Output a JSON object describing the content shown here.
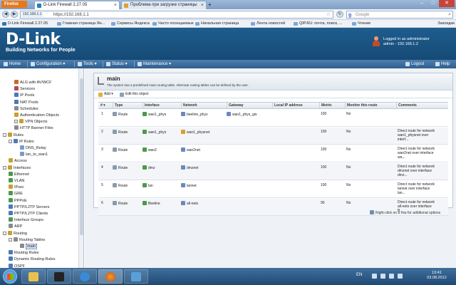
{
  "browser": {
    "menu_label": "Firefox",
    "tabs": [
      {
        "title": "D-Link Firewall 2.27.05"
      },
      {
        "title": "Проблема при загрузке страницы"
      }
    ],
    "new_tab_glyph": "+",
    "url_site": "192.168.1.1",
    "url": "https://192.168.1.1",
    "search_placeholder": "Google",
    "bookmarks": [
      "D-Link Firewall 2.27.05",
      "Главная страница Ян...",
      "Сервисы Яндекса",
      "Часто посещаемые",
      "Начальная страница",
      "Лента новостей",
      "QIP.RU: почта, поиск, ...",
      "Чтение"
    ],
    "bookmarks_menu": "Закладки"
  },
  "header": {
    "logo": "D-Link",
    "tagline": "Building Networks for People",
    "user_line1": "Logged in as administrator",
    "user_line2": "admin - 192.168.1.2"
  },
  "menu": {
    "items": [
      "Home",
      "Configuration ▾",
      "Tools ▾",
      "Status ▾",
      "Maintenance ▾"
    ],
    "logout": "Logout",
    "help": "Help"
  },
  "sidebar": {
    "items": [
      {
        "label": "ALG with AV/WCF",
        "level": 2,
        "icon": "alg-icon",
        "color": "#c86a2a"
      },
      {
        "label": "Services",
        "level": 2,
        "icon": "services-icon",
        "color": "#b84a4a"
      },
      {
        "label": "IP Pools",
        "level": 2,
        "icon": "ip-pools-icon",
        "color": "#4a7ab8"
      },
      {
        "label": "NAT Pools",
        "level": 2,
        "icon": "nat-pools-icon",
        "color": "#4a7ab8"
      },
      {
        "label": "Schedules",
        "level": 2,
        "icon": "schedules-icon",
        "color": "#8a8a8a"
      },
      {
        "label": "Authentication Objects",
        "level": 2,
        "icon": "auth-objects-icon",
        "color": "#c8a030"
      },
      {
        "label": "VPN Objects",
        "level": 2,
        "icon": "vpn-objects-icon",
        "color": "#c8a030",
        "expander": "+"
      },
      {
        "label": "HTTP Banner Files",
        "level": 2,
        "icon": "banner-files-icon",
        "color": "#8a8a8a"
      },
      {
        "label": "Rules",
        "level": 0,
        "icon": "rules-icon",
        "color": "#c8a030",
        "expander": "-"
      },
      {
        "label": "IP Rules",
        "level": 1,
        "icon": "ip-rules-icon",
        "color": "#4a7ab8",
        "expander": "-"
      },
      {
        "label": "DNS_Relay",
        "level": 3,
        "icon": "dns-relay-icon",
        "color": "#7a9ac8"
      },
      {
        "label": "lan_to_wan1",
        "level": 3,
        "icon": "lan-to-wan1-icon",
        "color": "#7a9ac8"
      },
      {
        "label": "Access",
        "level": 1,
        "icon": "access-icon",
        "color": "#c8a030"
      },
      {
        "label": "Interfaces",
        "level": 0,
        "icon": "interfaces-icon",
        "color": "#c8a030",
        "expander": "-"
      },
      {
        "label": "Ethernet",
        "level": 1,
        "icon": "ethernet-icon",
        "color": "#4a9a4a"
      },
      {
        "label": "VLAN",
        "level": 1,
        "icon": "vlan-icon",
        "color": "#4a9a4a"
      },
      {
        "label": "IPsec",
        "level": 1,
        "icon": "ipsec-icon",
        "color": "#c8a030"
      },
      {
        "label": "GRE",
        "level": 1,
        "icon": "gre-icon",
        "color": "#4a9a4a"
      },
      {
        "label": "PPPoE",
        "level": 1,
        "icon": "pppoe-icon",
        "color": "#4a9a4a"
      },
      {
        "label": "PPTP/L2TP Servers",
        "level": 1,
        "icon": "pptp-servers-icon",
        "color": "#4a7ab8"
      },
      {
        "label": "PPTP/L2TP Clients",
        "level": 1,
        "icon": "pptp-clients-icon",
        "color": "#4a7ab8"
      },
      {
        "label": "Interface Groups",
        "level": 1,
        "icon": "interface-groups-icon",
        "color": "#4a9a4a"
      },
      {
        "label": "ARP",
        "level": 1,
        "icon": "arp-icon",
        "color": "#8a8a8a"
      },
      {
        "label": "Routing",
        "level": 0,
        "icon": "routing-icon",
        "color": "#c8a030",
        "expander": "-"
      },
      {
        "label": "Routing Tables",
        "level": 1,
        "icon": "routing-tables-icon",
        "color": "#8a8a8a",
        "expander": "-"
      },
      {
        "label": "main",
        "level": 3,
        "icon": "main-table-icon",
        "color": "#8a8a8a",
        "selected": true
      },
      {
        "label": "Routing Rules",
        "level": 1,
        "icon": "routing-rules-icon",
        "color": "#4a7ab8"
      },
      {
        "label": "Dynamic Routing Rules",
        "level": 1,
        "icon": "dynamic-routing-rules-icon",
        "color": "#4a7ab8"
      },
      {
        "label": "OSPF",
        "level": 1,
        "icon": "ospf-icon",
        "color": "#4a7ab8"
      }
    ]
  },
  "panel": {
    "title": "main",
    "description": "The system has a predefined main routing table. Alternate routing tables can be defined by the user.",
    "add_label": "Add ▾",
    "edit_label": "Edit this object"
  },
  "table": {
    "columns": [
      "#",
      "Type",
      "Interface",
      "Network",
      "Gateway",
      "Local IP address",
      "Metric",
      "Monitor this route",
      "Comments"
    ],
    "sort_indicator": "▾",
    "rows": [
      {
        "num": "1",
        "type": "Route",
        "interface": "wan1_phys",
        "network": "beeline_phys",
        "gateway": "wan1_phys_gw",
        "local_ip": "",
        "metric": "100",
        "monitor": "No",
        "comment": ""
      },
      {
        "num": "2",
        "type": "Route",
        "interface": "wan1_phys",
        "network": "wan1_physnet",
        "gateway": "",
        "local_ip": "",
        "metric": "100",
        "monitor": "No",
        "comment": "Direct route for network wan1_physnet over interf..."
      },
      {
        "num": "3",
        "type": "Route",
        "interface": "wan2",
        "network": "wan2net",
        "gateway": "",
        "local_ip": "",
        "metric": "100",
        "monitor": "No",
        "comment": "Direct route for network wan2net over interface wa..."
      },
      {
        "num": "4",
        "type": "Route",
        "interface": "dmz",
        "network": "dmznet",
        "gateway": "",
        "local_ip": "",
        "metric": "100",
        "monitor": "No",
        "comment": "Direct route for network dmznet over interface dmz..."
      },
      {
        "num": "5",
        "type": "Route",
        "interface": "lan",
        "network": "lannet",
        "gateway": "",
        "local_ip": "",
        "metric": "100",
        "monitor": "No",
        "comment": "Direct route for network lannet over interface lan..."
      },
      {
        "num": "6",
        "type": "Route",
        "interface": "Beeline",
        "network": "all-nets",
        "gateway": "",
        "local_ip": "",
        "metric": "90",
        "monitor": "No",
        "comment": "Direct route for network all-nets over interface B..."
      }
    ]
  },
  "hint": "Right-click on a row for additional options",
  "taskbar": {
    "lang": "EN",
    "time": "13:41",
    "date": "03.08.2012"
  },
  "colors": {
    "header_blue": "#1e5d8f",
    "menu_blue": "#3a6a99",
    "firefox_orange": "#e8781a"
  }
}
